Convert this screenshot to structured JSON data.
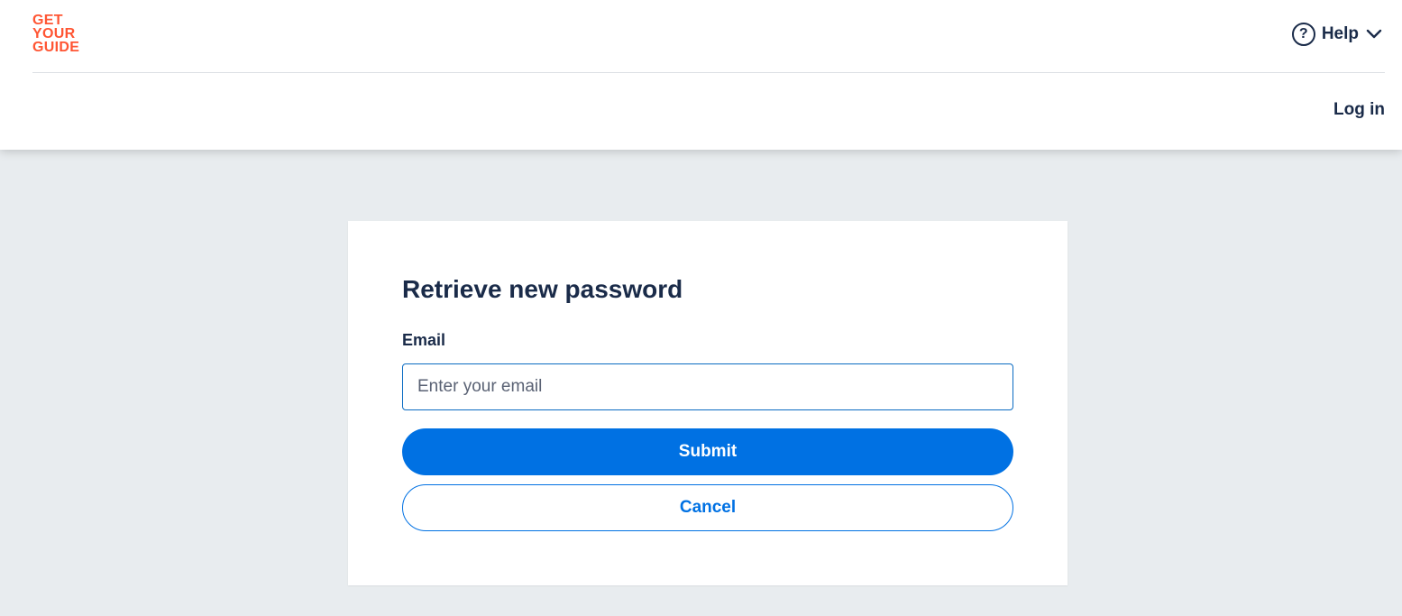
{
  "header": {
    "logo_lines": [
      "GET",
      "YOUR",
      "GUIDE"
    ],
    "help_icon_glyph": "?",
    "help_label": "Help",
    "login_label": "Log in"
  },
  "form": {
    "title": "Retrieve new password",
    "email_label": "Email",
    "email_placeholder": "Enter your email",
    "email_value": "",
    "submit_label": "Submit",
    "cancel_label": "Cancel"
  },
  "colors": {
    "brand": "#ff5533",
    "primary": "#0071e3",
    "text": "#1a2b49",
    "background": "#e8ecef"
  },
  "icons": {
    "help": "question-circle-icon",
    "chevron": "chevron-down-icon"
  }
}
